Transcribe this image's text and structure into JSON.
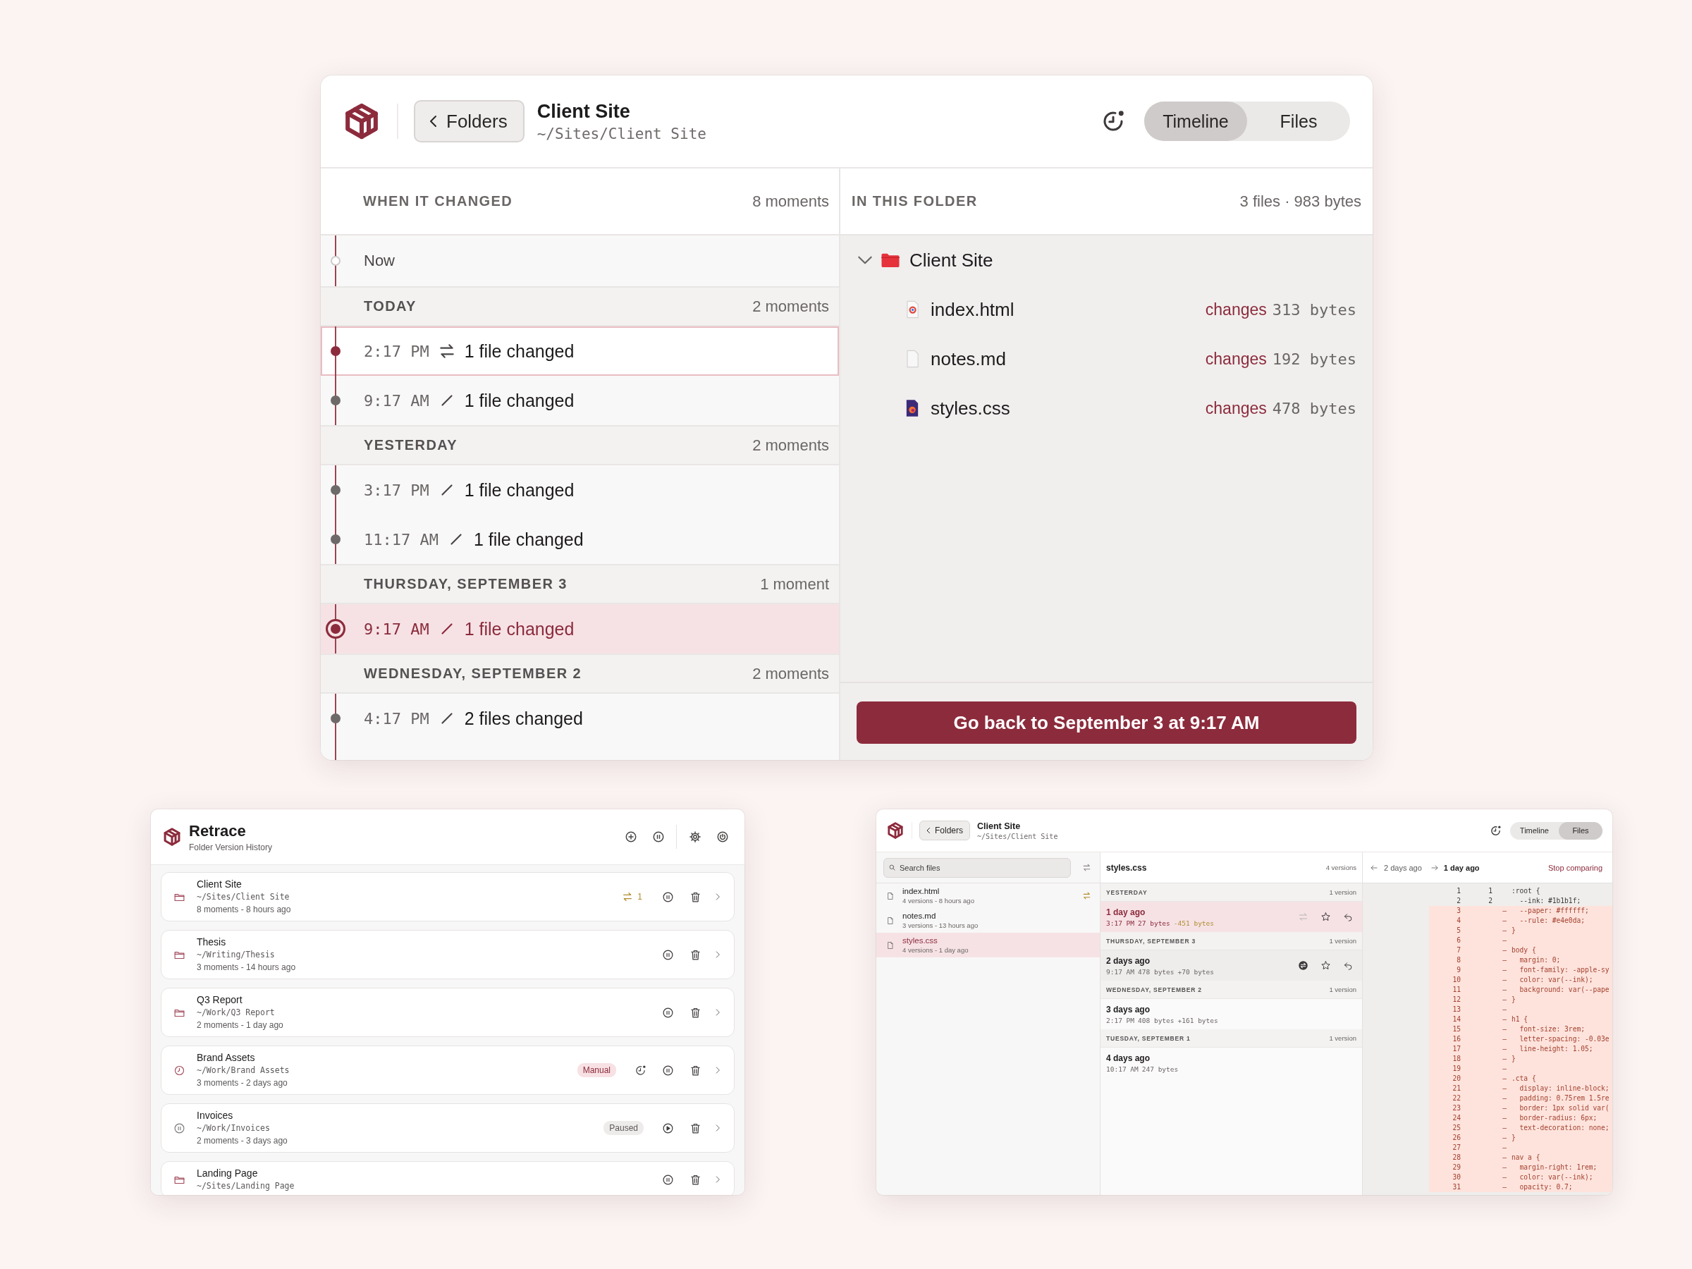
{
  "main_window": {
    "header": {
      "back_label": "Folders",
      "title": "Client Site",
      "path": "~/Sites/Client Site",
      "tabs": [
        {
          "label": "Timeline",
          "selected": true
        },
        {
          "label": "Files",
          "selected": false
        }
      ]
    },
    "timeline": {
      "heading": "WHEN IT CHANGED",
      "count": "8 moments",
      "now_label": "Now",
      "groups": [
        {
          "day": "TODAY",
          "count": "2 moments",
          "events": [
            {
              "time": "2:17 PM",
              "kind": "sync",
              "summary": "1 file changed",
              "selected": false,
              "focused": true
            },
            {
              "time": "9:17 AM",
              "kind": "edit",
              "summary": "1 file changed",
              "selected": false,
              "focused": false
            }
          ]
        },
        {
          "day": "YESTERDAY",
          "count": "2 moments",
          "events": [
            {
              "time": "3:17 PM",
              "kind": "edit",
              "summary": "1 file changed",
              "selected": false,
              "focused": false
            },
            {
              "time": "11:17 AM",
              "kind": "edit",
              "summary": "1 file changed",
              "selected": false,
              "focused": false
            }
          ]
        },
        {
          "day": "THURSDAY, SEPTEMBER 3",
          "count": "1 moment",
          "events": [
            {
              "time": "9:17 AM",
              "kind": "edit",
              "summary": "1 file changed",
              "selected": true,
              "focused": false
            }
          ]
        },
        {
          "day": "WEDNESDAY, SEPTEMBER 2",
          "count": "2 moments",
          "events": [
            {
              "time": "4:17 PM",
              "kind": "edit",
              "summary": "2 files changed",
              "selected": false,
              "focused": false
            }
          ]
        }
      ]
    },
    "folder_panel": {
      "heading": "IN THIS FOLDER",
      "summary": "3 files · 983 bytes",
      "folder": {
        "name": "Client Site",
        "expanded": true,
        "files": [
          {
            "name": "index.html",
            "kind": "html",
            "change_label": "changes",
            "size": "313 bytes"
          },
          {
            "name": "notes.md",
            "kind": "text",
            "change_label": "changes",
            "size": "192 bytes"
          },
          {
            "name": "styles.css",
            "kind": "css",
            "change_label": "changes",
            "size": "478 bytes"
          }
        ]
      },
      "restore_button": "Go back to September 3 at 9:17 AM"
    }
  },
  "folders_window": {
    "app_name": "Retrace",
    "subtitle": "Folder Version History",
    "folders": [
      {
        "name": "Client Site",
        "path": "~/Sites/Client Site",
        "meta": "8 moments - 8 hours ago",
        "kind": "auto",
        "pending": "1"
      },
      {
        "name": "Thesis",
        "path": "~/Writing/Thesis",
        "meta": "3 moments - 14 hours ago",
        "kind": "auto"
      },
      {
        "name": "Q3 Report",
        "path": "~/Work/Q3 Report",
        "meta": "2 moments - 1 day ago",
        "kind": "auto"
      },
      {
        "name": "Brand Assets",
        "path": "~/Work/Brand Assets",
        "meta": "3 moments - 2 days ago",
        "kind": "manual",
        "badge": "Manual"
      },
      {
        "name": "Invoices",
        "path": "~/Work/Invoices",
        "meta": "2 moments - 3 days ago",
        "kind": "paused",
        "badge": "Paused"
      },
      {
        "name": "Landing Page",
        "path": "~/Sites/Landing Page",
        "kind": "auto"
      }
    ]
  },
  "files_window": {
    "header": {
      "back_label": "Folders",
      "title": "Client Site",
      "path": "~/Sites/Client Site",
      "tabs": [
        {
          "label": "Timeline",
          "selected": false
        },
        {
          "label": "Files",
          "selected": true
        }
      ]
    },
    "sidebar": {
      "search_placeholder": "Search files",
      "files": [
        {
          "name": "index.html",
          "meta": "4 versions - 8 hours ago",
          "selected": false,
          "pending": true
        },
        {
          "name": "notes.md",
          "meta": "3 versions - 13 hours ago",
          "selected": false,
          "pending": false
        },
        {
          "name": "styles.css",
          "meta": "4 versions - 1 day ago",
          "selected": true,
          "pending": false
        }
      ]
    },
    "versions": {
      "title": "styles.css",
      "count": "4 versions",
      "groups": [
        {
          "day": "YESTERDAY",
          "count": "1 version",
          "versions": [
            {
              "ago": "1 day ago",
              "time": "3:17 PM",
              "size": "27 bytes",
              "delta": {
                "text": "-451 bytes",
                "kind": "shrink"
              },
              "selected": true,
              "compared": false
            }
          ]
        },
        {
          "day": "THURSDAY, SEPTEMBER 3",
          "count": "1 version",
          "versions": [
            {
              "ago": "2 days ago",
              "time": "9:17 AM",
              "size": "478 bytes",
              "delta": {
                "text": "+70 bytes",
                "kind": "grow"
              },
              "selected": false,
              "compared": true
            }
          ]
        },
        {
          "day": "WEDNESDAY, SEPTEMBER 2",
          "count": "1 version",
          "versions": [
            {
              "ago": "3 days ago",
              "time": "2:17 PM",
              "size": "408 bytes",
              "delta": {
                "text": "+161 bytes",
                "kind": "grow"
              },
              "selected": false,
              "compared": false
            }
          ]
        },
        {
          "day": "TUESDAY, SEPTEMBER 1",
          "count": "1 version",
          "versions": [
            {
              "ago": "4 days ago",
              "time": "10:17 AM",
              "size": "247 bytes",
              "selected": false,
              "compared": false
            }
          ]
        }
      ]
    },
    "diff": {
      "from": "2 days ago",
      "to": "1 day ago",
      "stop_label": "Stop comparing",
      "lines": [
        {
          "old": "1",
          "new": "1",
          "kind": "context",
          "code": ":root {"
        },
        {
          "old": "2",
          "new": "2",
          "kind": "context",
          "code": "  --ink: #1b1b1f;"
        },
        {
          "old": "3",
          "kind": "removed",
          "sign": "–",
          "code": "  --paper: #ffffff;"
        },
        {
          "old": "4",
          "kind": "removed",
          "sign": "–",
          "code": "  --rule: #e4e0da;"
        },
        {
          "old": "5",
          "kind": "removed",
          "sign": "–",
          "code": "}"
        },
        {
          "old": "6",
          "kind": "removed",
          "sign": "–"
        },
        {
          "old": "7",
          "kind": "removed",
          "sign": "–",
          "code": "body {"
        },
        {
          "old": "8",
          "kind": "removed",
          "sign": "–",
          "code": "  margin: 0;"
        },
        {
          "old": "9",
          "kind": "removed",
          "sign": "–",
          "code": "  font-family: -apple-sy"
        },
        {
          "old": "10",
          "kind": "removed",
          "sign": "–",
          "code": "  color: var(--ink);"
        },
        {
          "old": "11",
          "kind": "removed",
          "sign": "–",
          "code": "  background: var(--pape"
        },
        {
          "old": "12",
          "kind": "removed",
          "sign": "–",
          "code": "}"
        },
        {
          "old": "13",
          "kind": "removed",
          "sign": "–"
        },
        {
          "old": "14",
          "kind": "removed",
          "sign": "–",
          "code": "h1 {"
        },
        {
          "old": "15",
          "kind": "removed",
          "sign": "–",
          "code": "  font-size: 3rem;"
        },
        {
          "old": "16",
          "kind": "removed",
          "sign": "–",
          "code": "  letter-spacing: -0.03e"
        },
        {
          "old": "17",
          "kind": "removed",
          "sign": "–",
          "code": "  line-height: 1.05;"
        },
        {
          "old": "18",
          "kind": "removed",
          "sign": "–",
          "code": "}"
        },
        {
          "old": "19",
          "kind": "removed",
          "sign": "–"
        },
        {
          "old": "20",
          "kind": "removed",
          "sign": "–",
          "code": ".cta {"
        },
        {
          "old": "21",
          "kind": "removed",
          "sign": "–",
          "code": "  display: inline-block;"
        },
        {
          "old": "22",
          "kind": "removed",
          "sign": "–",
          "code": "  padding: 0.75rem 1.5re"
        },
        {
          "old": "23",
          "kind": "removed",
          "sign": "–",
          "code": "  border: 1px solid var("
        },
        {
          "old": "24",
          "kind": "removed",
          "sign": "–",
          "code": "  border-radius: 6px;"
        },
        {
          "old": "25",
          "kind": "removed",
          "sign": "–",
          "code": "  text-decoration: none;"
        },
        {
          "old": "26",
          "kind": "removed",
          "sign": "–",
          "code": "}"
        },
        {
          "old": "27",
          "kind": "removed",
          "sign": "–"
        },
        {
          "old": "28",
          "kind": "removed",
          "sign": "–",
          "code": "nav a {"
        },
        {
          "old": "29",
          "kind": "removed",
          "sign": "–",
          "code": "  margin-right: 1rem;"
        },
        {
          "old": "30",
          "kind": "removed",
          "sign": "–",
          "code": "  color: var(--ink);"
        },
        {
          "old": "31",
          "kind": "removed",
          "sign": "–",
          "code": "  opacity: 0.7;"
        }
      ]
    }
  }
}
